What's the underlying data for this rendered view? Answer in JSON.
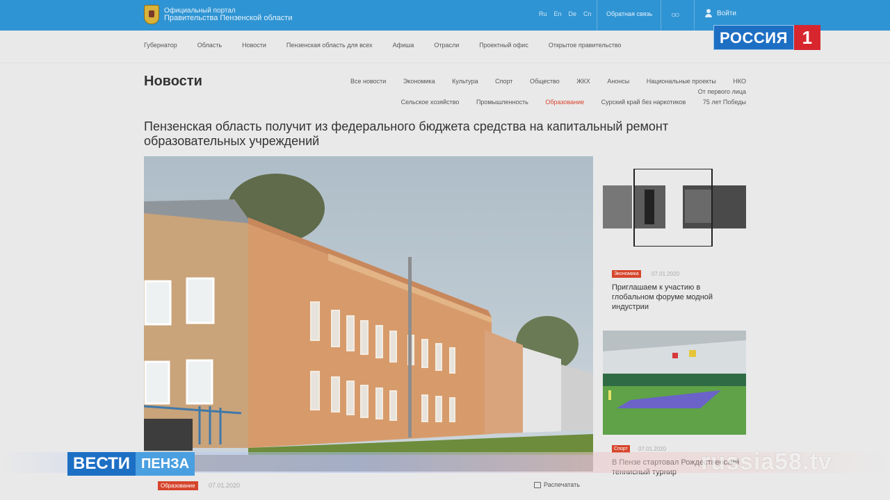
{
  "header": {
    "logo_line1": "Официальный портал",
    "logo_line2": "Правительства Пензенской области",
    "langs": [
      "Ru",
      "En",
      "De",
      "Cn"
    ],
    "feedback": "Обратная связь",
    "glasses": "○○",
    "login": "Войти"
  },
  "main_nav": [
    "Губернатор",
    "Область",
    "Новости",
    "Пензенская область для всех",
    "Афиша",
    "Отрасли",
    "Проектный офис",
    "Открытое правительство"
  ],
  "section": {
    "title": "Новости",
    "subnav_row1": [
      "Все новости",
      "Экономика",
      "Культура",
      "Спорт",
      "Общество",
      "ЖКХ",
      "Анонсы",
      "Национальные проекты",
      "НКО",
      "От первого лица"
    ],
    "subnav_row2": [
      "Сельское хозяйство",
      "Промышленность",
      "Образование",
      "Сурский край без наркотиков",
      "75 лет Победы"
    ],
    "active": "Образование"
  },
  "article": {
    "headline": "Пензенская область получит из федерального бюджета средства на капитальный ремонт образовательных учреждений",
    "category": "Образование",
    "date": "07.01.2020",
    "print": "Распечатать"
  },
  "sidebar": [
    {
      "category": "Экономика",
      "date": "07.01.2020",
      "text": "Приглашаем к участию в глобальном форуме модной индустрии"
    },
    {
      "category": "Спорт",
      "date": "07.01.2020",
      "text": "В Пензе стартовал Рождественский теннисный турнир"
    }
  ],
  "tv": {
    "channel_word": "РОССИЯ",
    "channel_num": "1",
    "vesti": "ВЕСТИ",
    "city": "ПЕНЗА",
    "site": "russia58.tv"
  },
  "colors": {
    "topbar": "#2f94d3",
    "accent": "#d6452c",
    "channel_blue": "#1d6fc4",
    "channel_red": "#d8262e"
  }
}
